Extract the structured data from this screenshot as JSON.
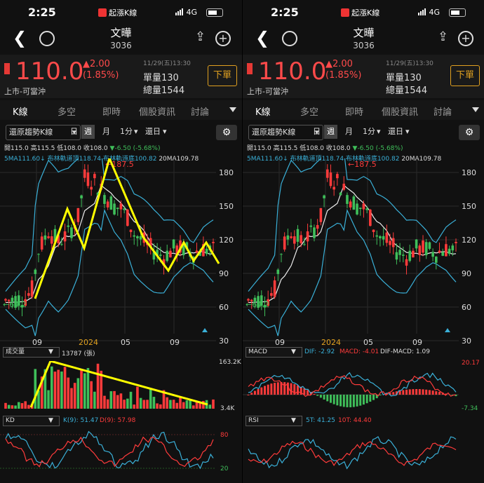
{
  "status": {
    "time": "2:25",
    "app": "起漲K線",
    "network": "4G"
  },
  "stock": {
    "name": "文曄",
    "code": "3036"
  },
  "quote": {
    "price": "110.0",
    "change": "▲2.00",
    "change_pct": "(1.85%)",
    "market": "上市-可當沖",
    "datetime": "11/29(五)13:30",
    "volume": "單量130",
    "total_volume": "總量1544",
    "order_button": "下單"
  },
  "tabs": [
    "K線",
    "多空",
    "即時",
    "個股資訊",
    "討論"
  ],
  "toolbar": {
    "mode": "還原趨勢K線",
    "mode_arrow": "▾",
    "periods": [
      "日",
      "週",
      "月",
      "1分"
    ],
    "period_arrow": "▾",
    "selected_period": "週",
    "range": "還日",
    "range_arrow": "▾"
  },
  "ohlc": "開115.0 高115.5 低108.0 收108.0",
  "ohlc_change": "▼-6.50 (-5.68%)",
  "indicators": {
    "ma5": "5MA111.60↓",
    "boll_upper": "布林軌道頂118.74",
    "boll_lower": "布林軌道底100.82",
    "ma20": "20MA109.78"
  },
  "price_axis": [
    "180",
    "150",
    "120",
    "90",
    "60",
    "30"
  ],
  "time_axis": [
    "09",
    "2024",
    "05",
    "09"
  ],
  "high_label": "←187.5",
  "low_label": "←64.2",
  "left": {
    "volume_label": "成交量",
    "volume_value": "13787 (張)",
    "vol_max": "163.2K",
    "vol_min": "3.4K",
    "kd_label": "KD",
    "k_value": "K(9): 51.47",
    "d_value": "D(9): 57.98",
    "kd_top": "80",
    "kd_bottom": "20"
  },
  "right": {
    "macd_label": "MACD",
    "dif": "DIF: -2.92",
    "macd": "MACD: -4.01",
    "dif_macd": "DIF-MACD: 1.09",
    "macd_top": "20.17",
    "macd_bottom": "-7.34",
    "rsi_label": "RSI",
    "rsi5": "5T: 41.25",
    "rsi10": "10T: 44.40"
  },
  "colors": {
    "up": "#ff3b3b",
    "down": "#3fbf5a",
    "boll": "#3ab0d8",
    "ma": "#eeeeee",
    "annotation": "#ffff00"
  }
}
